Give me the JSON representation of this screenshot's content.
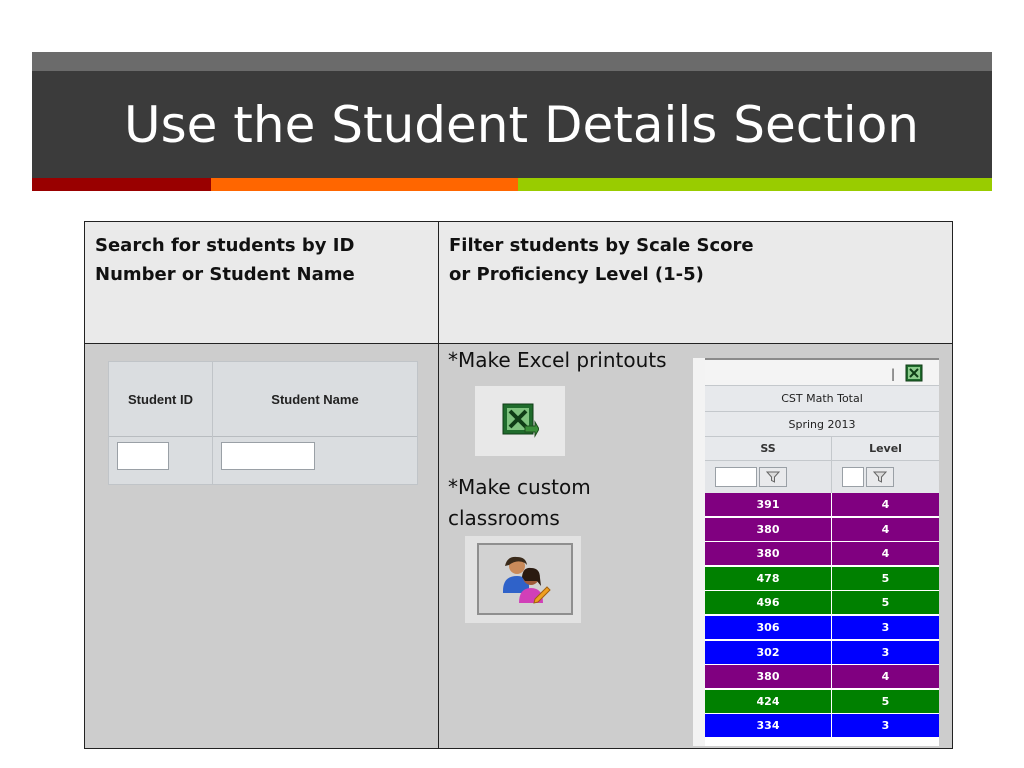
{
  "slide": {
    "title": "Use the Student Details Section"
  },
  "table": {
    "left_header": [
      "Search for students by ID",
      "Number or Student Name"
    ],
    "right_header": [
      "Filter students by Scale Score",
      "or Proficiency Level (1-5)"
    ]
  },
  "search_widget": {
    "student_id_label": "Student ID",
    "student_name_label": "Student Name",
    "student_id_value": "",
    "student_name_value": ""
  },
  "notes": {
    "excel": "*Make Excel printouts",
    "custom_lines": [
      "*Make custom",
      "classrooms"
    ]
  },
  "icons": {
    "excel": "excel-export-icon",
    "classroom": "custom-classroom-icon",
    "filter": "filter-funnel-icon"
  },
  "grid": {
    "separator": "|",
    "group_title": "CST Math Total",
    "period": "Spring 2013",
    "columns": [
      "SS",
      "Level"
    ],
    "level_colors": {
      "3": "#0000ff",
      "4": "#800080",
      "5": "#008000"
    },
    "rows": [
      {
        "ss": "391",
        "level": "4"
      },
      {
        "ss": "380",
        "level": "4"
      },
      {
        "ss": "380",
        "level": "4"
      },
      {
        "ss": "478",
        "level": "5"
      },
      {
        "ss": "496",
        "level": "5"
      },
      {
        "ss": "306",
        "level": "3"
      },
      {
        "ss": "302",
        "level": "3"
      },
      {
        "ss": "380",
        "level": "4"
      },
      {
        "ss": "424",
        "level": "5"
      },
      {
        "ss": "334",
        "level": "3"
      }
    ]
  }
}
